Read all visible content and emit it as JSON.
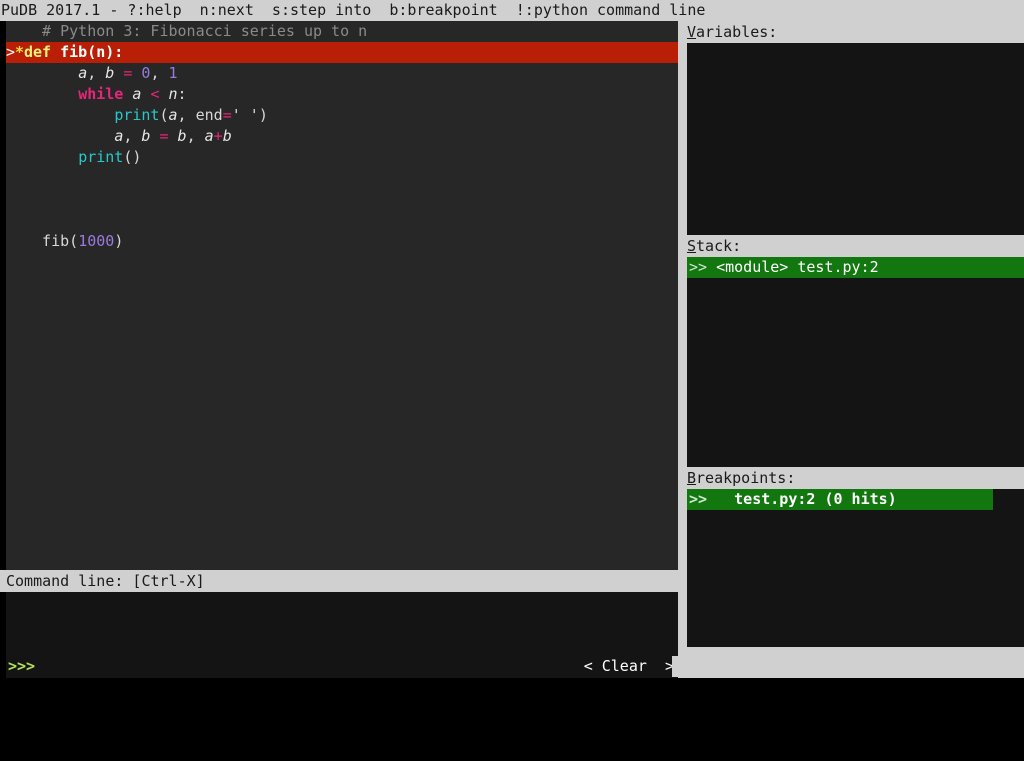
{
  "titlebar": {
    "text": "PuDB 2017.1 - ?:help  n:next  s:step into  b:breakpoint  !:python command line"
  },
  "source": {
    "lines": [
      {
        "marker": "",
        "highlight": false,
        "tokens": [
          {
            "text": "  # Python 3: Fibonacci series up to n",
            "style": "comment"
          }
        ]
      },
      {
        "marker": ">*",
        "highlight": true,
        "tokens": [
          {
            "text": "def ",
            "style": "hl-def"
          },
          {
            "text": "fib(n):",
            "style": "hl-fname"
          }
        ]
      },
      {
        "marker": "",
        "highlight": false,
        "tokens": [
          {
            "text": "      ",
            "style": "plain"
          },
          {
            "text": "a",
            "style": "name"
          },
          {
            "text": ", ",
            "style": "plain"
          },
          {
            "text": "b",
            "style": "name"
          },
          {
            "text": " ",
            "style": "plain"
          },
          {
            "text": "=",
            "style": "op"
          },
          {
            "text": " ",
            "style": "plain"
          },
          {
            "text": "0",
            "style": "num"
          },
          {
            "text": ", ",
            "style": "plain"
          },
          {
            "text": "1",
            "style": "num"
          }
        ]
      },
      {
        "marker": "",
        "highlight": false,
        "tokens": [
          {
            "text": "      ",
            "style": "plain"
          },
          {
            "text": "while",
            "style": "kw"
          },
          {
            "text": " ",
            "style": "plain"
          },
          {
            "text": "a",
            "style": "name"
          },
          {
            "text": " ",
            "style": "plain"
          },
          {
            "text": "<",
            "style": "op"
          },
          {
            "text": " ",
            "style": "plain"
          },
          {
            "text": "n",
            "style": "name"
          },
          {
            "text": ":",
            "style": "plain"
          }
        ]
      },
      {
        "marker": "",
        "highlight": false,
        "tokens": [
          {
            "text": "          ",
            "style": "plain"
          },
          {
            "text": "print",
            "style": "builtin"
          },
          {
            "text": "(",
            "style": "plain"
          },
          {
            "text": "a",
            "style": "name"
          },
          {
            "text": ", ",
            "style": "plain"
          },
          {
            "text": "end",
            "style": "plain"
          },
          {
            "text": "=",
            "style": "op"
          },
          {
            "text": "' '",
            "style": "str"
          },
          {
            "text": ")",
            "style": "plain"
          }
        ]
      },
      {
        "marker": "",
        "highlight": false,
        "tokens": [
          {
            "text": "          ",
            "style": "plain"
          },
          {
            "text": "a",
            "style": "name"
          },
          {
            "text": ", ",
            "style": "plain"
          },
          {
            "text": "b",
            "style": "name"
          },
          {
            "text": " ",
            "style": "plain"
          },
          {
            "text": "=",
            "style": "op"
          },
          {
            "text": " ",
            "style": "plain"
          },
          {
            "text": "b",
            "style": "name"
          },
          {
            "text": ", ",
            "style": "plain"
          },
          {
            "text": "a",
            "style": "name"
          },
          {
            "text": "+",
            "style": "op"
          },
          {
            "text": "b",
            "style": "name"
          }
        ]
      },
      {
        "marker": "",
        "highlight": false,
        "tokens": [
          {
            "text": "      ",
            "style": "plain"
          },
          {
            "text": "print",
            "style": "builtin"
          },
          {
            "text": "()",
            "style": "plain"
          }
        ]
      },
      {
        "marker": "",
        "highlight": false,
        "tokens": [
          {
            "text": "",
            "style": "plain"
          }
        ]
      },
      {
        "marker": "",
        "highlight": false,
        "tokens": [
          {
            "text": "",
            "style": "plain"
          }
        ]
      },
      {
        "marker": "",
        "highlight": false,
        "tokens": [
          {
            "text": "",
            "style": "plain"
          }
        ]
      },
      {
        "marker": "",
        "highlight": false,
        "tokens": [
          {
            "text": "  fib(",
            "style": "plain"
          },
          {
            "text": "1000",
            "style": "num"
          },
          {
            "text": ")",
            "style": "plain"
          }
        ]
      }
    ]
  },
  "command_line": {
    "header": "Command line: [Ctrl-X]",
    "prompt": ">>>",
    "input_value": "",
    "clear_button": "< Clear  >"
  },
  "sidebar": {
    "variables": {
      "hotkey": "V",
      "label_rest": "ariables:",
      "items": []
    },
    "stack": {
      "hotkey": "S",
      "label_rest": "tack:",
      "rows": [
        {
          "marker": ">>",
          "text": " <module> test.py:2",
          "selected": true
        }
      ]
    },
    "breakpoints": {
      "hotkey": "B",
      "label_rest": "reakpoints:",
      "rows": [
        {
          "marker": ">>",
          "text": "   test.py:2 (0 hits)",
          "selected": true
        }
      ]
    }
  },
  "colors": {
    "titlebar_bg": "#d0d0d0",
    "source_bg": "#272727",
    "current_line_bg": "#b81f06",
    "panel_bg": "#141414",
    "selected_row_bg": "#12770f",
    "prompt_green": "#b5e05a"
  }
}
